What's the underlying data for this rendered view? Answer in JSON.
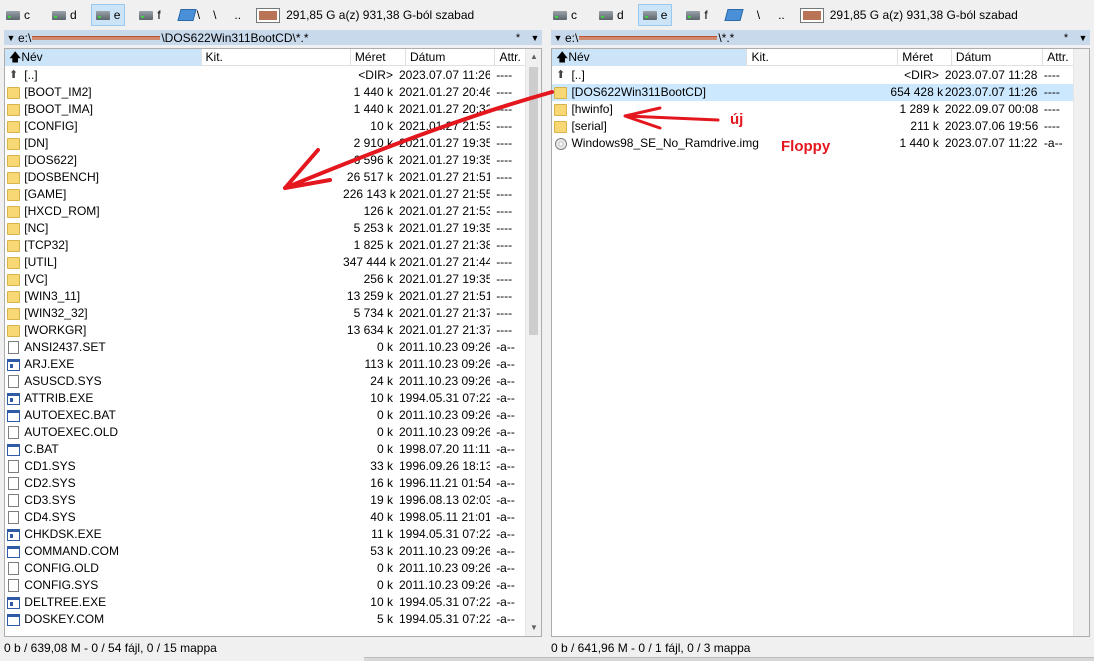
{
  "drives": [
    "c",
    "d",
    "e",
    "f"
  ],
  "active_drive": "e",
  "tool_root": "\\",
  "tool_up": "..",
  "left": {
    "free_space": "291,85 G a(z) 931,38 G-ból szabad",
    "path_prefix": "e:\\",
    "path_suffix": "\\DOS622Win311BootCD\\*.*",
    "filter_star": "*",
    "columns": {
      "name": "Név",
      "ext": "Kit.",
      "size": "Méret",
      "date": "Dátum",
      "attr": "Attr."
    },
    "rows": [
      {
        "icon": "up",
        "name": "[..]",
        "size": "<DIR>",
        "date": "2023.07.07 11:26",
        "attr": "----"
      },
      {
        "icon": "folder",
        "name": "[BOOT_IM2]",
        "size": "1 440 k",
        "date": "2021.01.27 20:46",
        "attr": "----"
      },
      {
        "icon": "folder",
        "name": "[BOOT_IMA]",
        "size": "1 440 k",
        "date": "2021.01.27 20:32",
        "attr": "----"
      },
      {
        "icon": "folder",
        "name": "[CONFIG]",
        "size": "10 k",
        "date": "2021.01.27 21:53",
        "attr": "----"
      },
      {
        "icon": "folder",
        "name": "[DN]",
        "size": "2 910 k",
        "date": "2021.01.27 19:35",
        "attr": "----"
      },
      {
        "icon": "folder",
        "name": "[DOS622]",
        "size": "6 596 k",
        "date": "2021.01.27 19:35",
        "attr": "----"
      },
      {
        "icon": "folder",
        "name": "[DOSBENCH]",
        "size": "26 517 k",
        "date": "2021.01.27 21:51",
        "attr": "----"
      },
      {
        "icon": "folder",
        "name": "[GAME]",
        "size": "226 143 k",
        "date": "2021.01.27 21:55",
        "attr": "----"
      },
      {
        "icon": "folder",
        "name": "[HXCD_ROM]",
        "size": "126 k",
        "date": "2021.01.27 21:53",
        "attr": "----"
      },
      {
        "icon": "folder",
        "name": "[NC]",
        "size": "5 253 k",
        "date": "2021.01.27 19:35",
        "attr": "----"
      },
      {
        "icon": "folder",
        "name": "[TCP32]",
        "size": "1 825 k",
        "date": "2021.01.27 21:38",
        "attr": "----"
      },
      {
        "icon": "folder",
        "name": "[UTIL]",
        "size": "347 444 k",
        "date": "2021.01.27 21:44",
        "attr": "----"
      },
      {
        "icon": "folder",
        "name": "[VC]",
        "size": "256 k",
        "date": "2021.01.27 19:35",
        "attr": "----"
      },
      {
        "icon": "folder",
        "name": "[WIN3_11]",
        "size": "13 259 k",
        "date": "2021.01.27 21:51",
        "attr": "----"
      },
      {
        "icon": "folder",
        "name": "[WIN32_32]",
        "size": "5 734 k",
        "date": "2021.01.27 21:37",
        "attr": "----"
      },
      {
        "icon": "folder",
        "name": "[WORKGR]",
        "size": "13 634 k",
        "date": "2021.01.27 21:37",
        "attr": "----"
      },
      {
        "icon": "file",
        "name": "ANSI2437.SET",
        "size": "0 k",
        "date": "2011.10.23 09:26",
        "attr": "-a--"
      },
      {
        "icon": "exe",
        "name": "ARJ.EXE",
        "size": "113 k",
        "date": "2011.10.23 09:26",
        "attr": "-a--"
      },
      {
        "icon": "file",
        "name": "ASUSCD.SYS",
        "size": "24 k",
        "date": "2011.10.23 09:26",
        "attr": "-a--"
      },
      {
        "icon": "exe",
        "name": "ATTRIB.EXE",
        "size": "10 k",
        "date": "1994.05.31 07:22",
        "attr": "-a--"
      },
      {
        "icon": "exe",
        "name": "AUTOEXEC.BAT",
        "size": "0 k",
        "date": "2011.10.23 09:26",
        "attr": "-a--"
      },
      {
        "icon": "file",
        "name": "AUTOEXEC.OLD",
        "size": "0 k",
        "date": "2011.10.23 09:26",
        "attr": "-a--"
      },
      {
        "icon": "exe",
        "name": "C.BAT",
        "size": "0 k",
        "date": "1998.07.20 11:11",
        "attr": "-a--"
      },
      {
        "icon": "file",
        "name": "CD1.SYS",
        "size": "33 k",
        "date": "1996.09.26 18:13",
        "attr": "-a--"
      },
      {
        "icon": "file",
        "name": "CD2.SYS",
        "size": "16 k",
        "date": "1996.11.21 01:54",
        "attr": "-a--"
      },
      {
        "icon": "file",
        "name": "CD3.SYS",
        "size": "19 k",
        "date": "1996.08.13 02:03",
        "attr": "-a--"
      },
      {
        "icon": "file",
        "name": "CD4.SYS",
        "size": "40 k",
        "date": "1998.05.11 21:01",
        "attr": "-a--"
      },
      {
        "icon": "exe",
        "name": "CHKDSK.EXE",
        "size": "11 k",
        "date": "1994.05.31 07:22",
        "attr": "-a--"
      },
      {
        "icon": "exe",
        "name": "COMMAND.COM",
        "size": "53 k",
        "date": "2011.10.23 09:26",
        "attr": "-a--"
      },
      {
        "icon": "file",
        "name": "CONFIG.OLD",
        "size": "0 k",
        "date": "2011.10.23 09:26",
        "attr": "-a--"
      },
      {
        "icon": "file",
        "name": "CONFIG.SYS",
        "size": "0 k",
        "date": "2011.10.23 09:26",
        "attr": "-a--"
      },
      {
        "icon": "exe",
        "name": "DELTREE.EXE",
        "size": "10 k",
        "date": "1994.05.31 07:22",
        "attr": "-a--"
      },
      {
        "icon": "exe",
        "name": "DOSKEY.COM",
        "size": "5 k",
        "date": "1994.05.31 07:22",
        "attr": "-a--"
      }
    ],
    "status": "0 b / 639,08 M - 0 / 54 fájl, 0 / 15 mappa"
  },
  "right": {
    "free_space": "291,85 G a(z) 931,38 G-ból szabad",
    "path_prefix": "e:\\",
    "path_suffix": "\\*.*",
    "filter_star": "*",
    "columns": {
      "name": "Név",
      "ext": "Kit.",
      "size": "Méret",
      "date": "Dátum",
      "attr": "Attr."
    },
    "rows": [
      {
        "icon": "up",
        "name": "[..]",
        "size": "<DIR>",
        "date": "2023.07.07 11:28",
        "attr": "----"
      },
      {
        "icon": "folder",
        "name": "[DOS622Win311BootCD]",
        "size": "654 428 k",
        "date": "2023.07.07 11:26",
        "attr": "----",
        "selected": true
      },
      {
        "icon": "folder",
        "name": "[hwinfo]",
        "size": "1 289 k",
        "date": "2022.09.07 00:08",
        "attr": "----"
      },
      {
        "icon": "folder",
        "name": "[serial]",
        "size": "211 k",
        "date": "2023.07.06 19:56",
        "attr": "----"
      },
      {
        "icon": "img",
        "name": "Windows98_SE_No_Ramdrive.img",
        "size": "1 440 k",
        "date": "2023.07.07 11:22",
        "attr": "-a--"
      }
    ],
    "status": "0 b / 641,96 M - 0 / 1 fájl, 0 / 3 mappa"
  },
  "annotations": {
    "uj": "új",
    "floppy": "Floppy",
    "color": "#e4161e"
  }
}
